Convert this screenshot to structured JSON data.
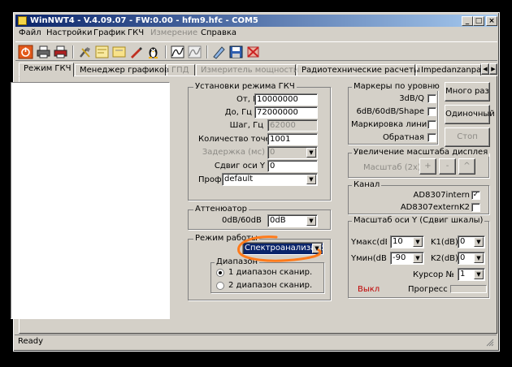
{
  "window": {
    "title": "WinNWT4 - V.4.09.07 - FW:0.00 - hfm9.hfc - COM5",
    "minimize": "_",
    "maximize": "□",
    "close": "×"
  },
  "menu": [
    {
      "label": "Файл"
    },
    {
      "label": "Настройки"
    },
    {
      "label": "График"
    },
    {
      "label": "ГКЧ"
    },
    {
      "label": "Измерение",
      "disabled": true
    },
    {
      "label": "Справка"
    }
  ],
  "toolbar": [
    "power-icon",
    "print-icon",
    "print-color-icon",
    "settings-icon",
    "calibrate-icon",
    "folder-icon",
    "pen-icon",
    "linux-icon",
    "sweep-icon",
    "sweep-pause-icon",
    "open-icon",
    "save-icon",
    "delete-icon"
  ],
  "tabs": [
    "Режим ГКЧ",
    "Менеджер графиков",
    "ГПД",
    "Измеритель мощности",
    "Радиотехнические расчеты",
    "Impedanzanpass"
  ],
  "tab_scroll": {
    "left": "◀",
    "right": "▶"
  },
  "sweep": {
    "title": "Установки режима ГКЧ",
    "from_label": "От, Гц",
    "from_value": "10000000",
    "to_label": "До, Гц",
    "to_value": "72000000",
    "step_label": "Шаг, Гц",
    "step_value": "62000",
    "points_label": "Количество точек",
    "points_value": "1001",
    "delay_label": "Задержка (мс)",
    "delay_value": "0",
    "yshift_label": "Сдвиг оси Y",
    "yshift_value": "0",
    "profile_label": "Проф",
    "profile_value": "default"
  },
  "attenuator": {
    "title": "Аттенюатор",
    "label": "0dB/60dB",
    "value": "0dB"
  },
  "mode": {
    "title": "Режим работы",
    "value": "Спектроанализатор",
    "range_title": "Диапазон",
    "range1": "1 диапазон сканир.",
    "range2": "2 диапазон сканир."
  },
  "markers": {
    "title": "Маркеры по уровню",
    "m3db": "3dB/Q",
    "m6db": "6dB/60dB/Shape",
    "lines": "Маркировка линий",
    "reverse": "Обратная"
  },
  "buttons": {
    "multi": "Много раз",
    "single": "Одиночный",
    "stop": "Стоп"
  },
  "zoom": {
    "title": "Увеличение масштаба дисплея",
    "label": "Масштаб (2x)",
    "plus": "+",
    "minus": "-",
    "star": "^"
  },
  "channel": {
    "title": "Канал",
    "intern": "AD8307intern",
    "extern": "AD8307externK2",
    "check": "✓"
  },
  "yscale": {
    "title": "Масштаб оси Y (Сдвиг шкалы)",
    "ymax_label": "Yмакс(dB",
    "ymax_value": "10",
    "ymin_label": "Yмин(dB",
    "ymin_value": "-90",
    "k1_label": "K1(dB)",
    "k1_value": "0",
    "k2_label": "K2(dB)",
    "k2_value": "0",
    "cursor_label": "Курсор №",
    "cursor_value": "1",
    "exit": "Выкл",
    "progress_label": "Прогресс"
  },
  "status": {
    "text": "Ready"
  },
  "colors": {
    "highlight": "#0a246a",
    "exit": "#c00000",
    "annotation": "#ff7a1a"
  }
}
